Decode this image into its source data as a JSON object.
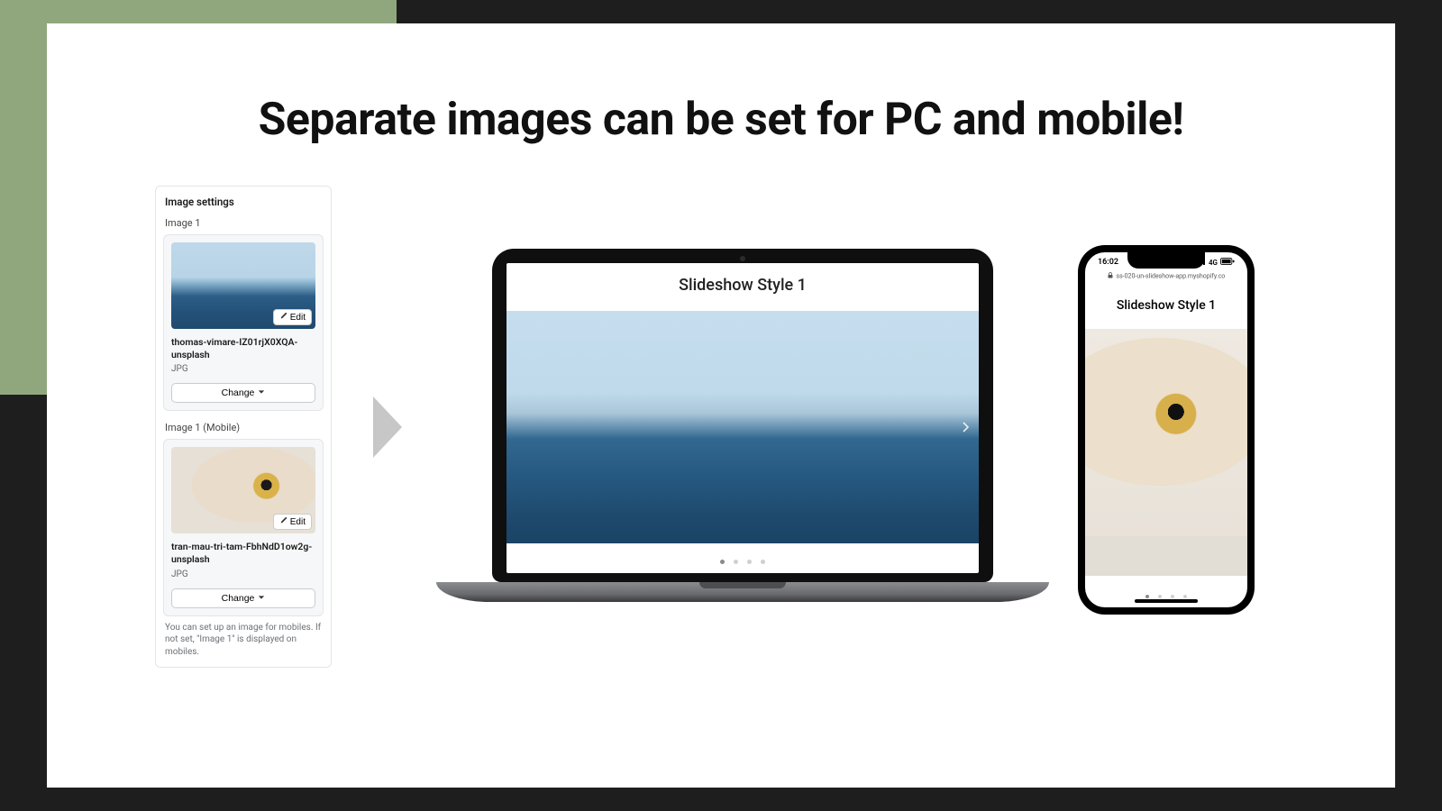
{
  "headline": "Separate images can be set for PC and mobile!",
  "settings": {
    "title": "Image settings",
    "image1": {
      "label": "Image 1",
      "edit_label": "Edit",
      "filename": "thomas-vimare-IZ01rjX0XQA-unsplash",
      "filetype": "JPG",
      "change_label": "Change"
    },
    "image1_mobile": {
      "label": "Image 1 (Mobile)",
      "edit_label": "Edit",
      "filename": "tran-mau-tri-tam-FbhNdD1ow2g-unsplash",
      "filetype": "JPG",
      "change_label": "Change"
    },
    "hint": "You can set up an image for mobiles. If not set, \"Image 1\" is displayed on mobiles."
  },
  "laptop": {
    "header": "Slideshow Style 1"
  },
  "phone": {
    "time": "16:02",
    "network_label": "4G",
    "url": "ss-020-un-slideshow-app.myshopify.co",
    "header": "Slideshow Style 1"
  }
}
